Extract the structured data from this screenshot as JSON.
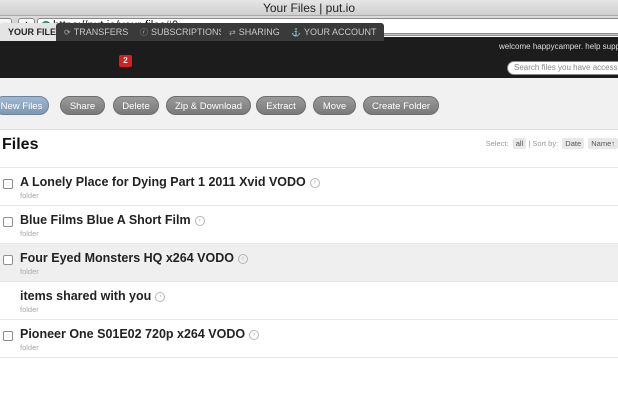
{
  "window": {
    "title": "Your Files | put.io"
  },
  "browser": {
    "url": "https://put.io/your-files#0",
    "add_label": "+"
  },
  "header": {
    "welcome": "welcome happycamper. help supp",
    "tabs": [
      {
        "label": "YOUR FILES",
        "icon": ""
      },
      {
        "label": "TRANSFERS",
        "icon": "⟳"
      },
      {
        "label": "SUBSCRIPTIONS",
        "icon": "ⓡ"
      },
      {
        "label": "SHARING",
        "icon": "⇄"
      },
      {
        "label": "YOUR ACCOUNT",
        "icon": "⚓"
      }
    ],
    "transfers_badge": "2",
    "search_placeholder": "Search files you have access"
  },
  "actions": [
    "New Files",
    "Share",
    "Delete",
    "Zip & Download",
    "Extract",
    "Move",
    "Create Folder"
  ],
  "files": {
    "title": "Files",
    "select_label": "Select:",
    "select_all": "all",
    "sort_label": "| Sort by:",
    "sort_date": "Date",
    "sort_name": "Name↑",
    "items": [
      {
        "name": "A Lonely Place for Dying Part 1 2011 Xvid VODO",
        "type": "folder",
        "checkbox": true
      },
      {
        "name": "Blue Films Blue A Short Film",
        "type": "folder",
        "checkbox": true
      },
      {
        "name": "Four Eyed Monsters HQ x264 VODO",
        "type": "folder",
        "checkbox": true
      },
      {
        "name": "items shared with you",
        "type": "folder",
        "checkbox": false
      },
      {
        "name": "Pioneer One S01E02 720p x264 VODO",
        "type": "folder",
        "checkbox": true
      }
    ]
  },
  "colors": {
    "header_bg": "#1c1c1c",
    "badge": "#d62020",
    "button": "#8a8a8a"
  }
}
